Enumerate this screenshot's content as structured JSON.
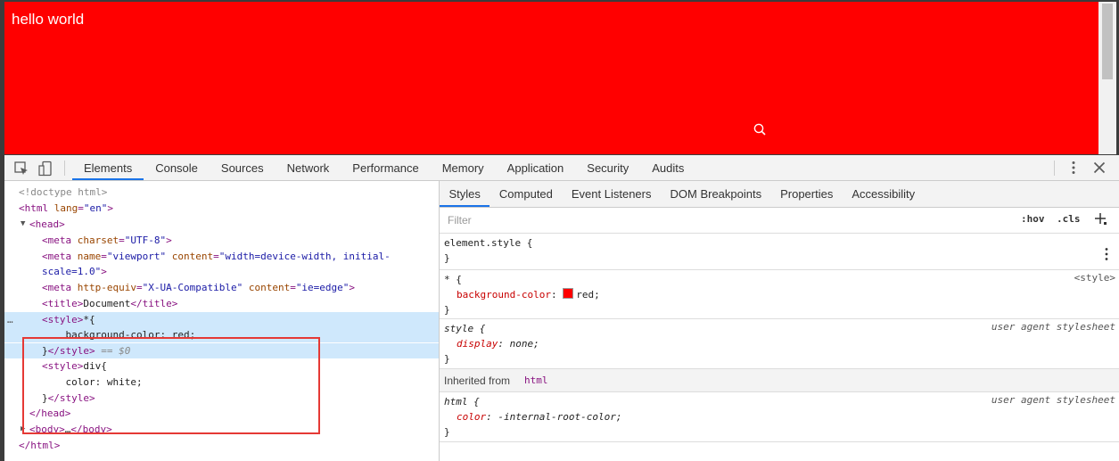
{
  "page": {
    "text": "hello world",
    "bg_color": "#ff0000"
  },
  "toolbar": {
    "tabs": [
      "Elements",
      "Console",
      "Sources",
      "Network",
      "Performance",
      "Memory",
      "Application",
      "Security",
      "Audits"
    ],
    "active_tab": "Elements"
  },
  "dom": {
    "doctype": "<!doctype html>",
    "html_open_tag": "<html",
    "lang_attr": "lang",
    "lang_val": "\"en\"",
    "head_tag": "<head>",
    "meta1": {
      "tag": "<meta",
      "attr": "charset",
      "val": "\"UTF-8\"",
      "close": ">"
    },
    "meta2": {
      "tag": "<meta",
      "attr1": "name",
      "val1": "\"viewport\"",
      "attr2": "content",
      "val2": "\"width=device-width, initial-",
      "cont": "scale=1.0\"",
      "close": ">"
    },
    "meta3": {
      "tag": "<meta",
      "attr1": "http-equiv",
      "val1": "\"X-UA-Compatible\"",
      "attr2": "content",
      "val2": "\"ie=edge\"",
      "close": ">"
    },
    "title_open": "<title>",
    "title_text": "Document",
    "title_close": "</title>",
    "style1_open": "<style>",
    "style1_text": "*{",
    "style1_body": "    background-color: red;",
    "style1_end_text": "}",
    "style1_close": "</style>",
    "style1_marker": " == $0",
    "style2_open": "<style>",
    "style2_text": "div{",
    "style2_body": "    color: white;",
    "style2_end_text": "}",
    "style2_close": "</style>",
    "head_close": "</head>",
    "body_open": "<body>",
    "body_ellipsis": "…",
    "body_close": "</body>",
    "html_close": "</html>",
    "gutter": "…"
  },
  "styles_panel": {
    "tabs": [
      "Styles",
      "Computed",
      "Event Listeners",
      "DOM Breakpoints",
      "Properties",
      "Accessibility"
    ],
    "active_tab": "Styles",
    "filter_placeholder": "Filter",
    "hov_label": ":hov",
    "cls_label": ".cls",
    "plus_label": "+",
    "element_style": {
      "selector": "element.style {",
      "close": "}"
    },
    "universal_rule": {
      "selector": "* {",
      "property": "background-color",
      "value": "red;",
      "source": "<style>",
      "close": "}",
      "swatch_color": "#ff0000"
    },
    "style_rule": {
      "selector": "style {",
      "property": "display",
      "value": "none;",
      "source": "user agent stylesheet",
      "close": "}"
    },
    "inherited": {
      "label": "Inherited from",
      "tag": "html"
    },
    "html_rule": {
      "selector": "html {",
      "property": "color",
      "value": "-internal-root-color;",
      "source": "user agent stylesheet",
      "close": "}"
    },
    "colon": ":"
  },
  "icons": [
    "inspect-element-icon",
    "device-toolbar-icon",
    "kebab-menu-icon",
    "close-icon",
    "search-cursor-icon",
    "new-style-rule-icon"
  ]
}
